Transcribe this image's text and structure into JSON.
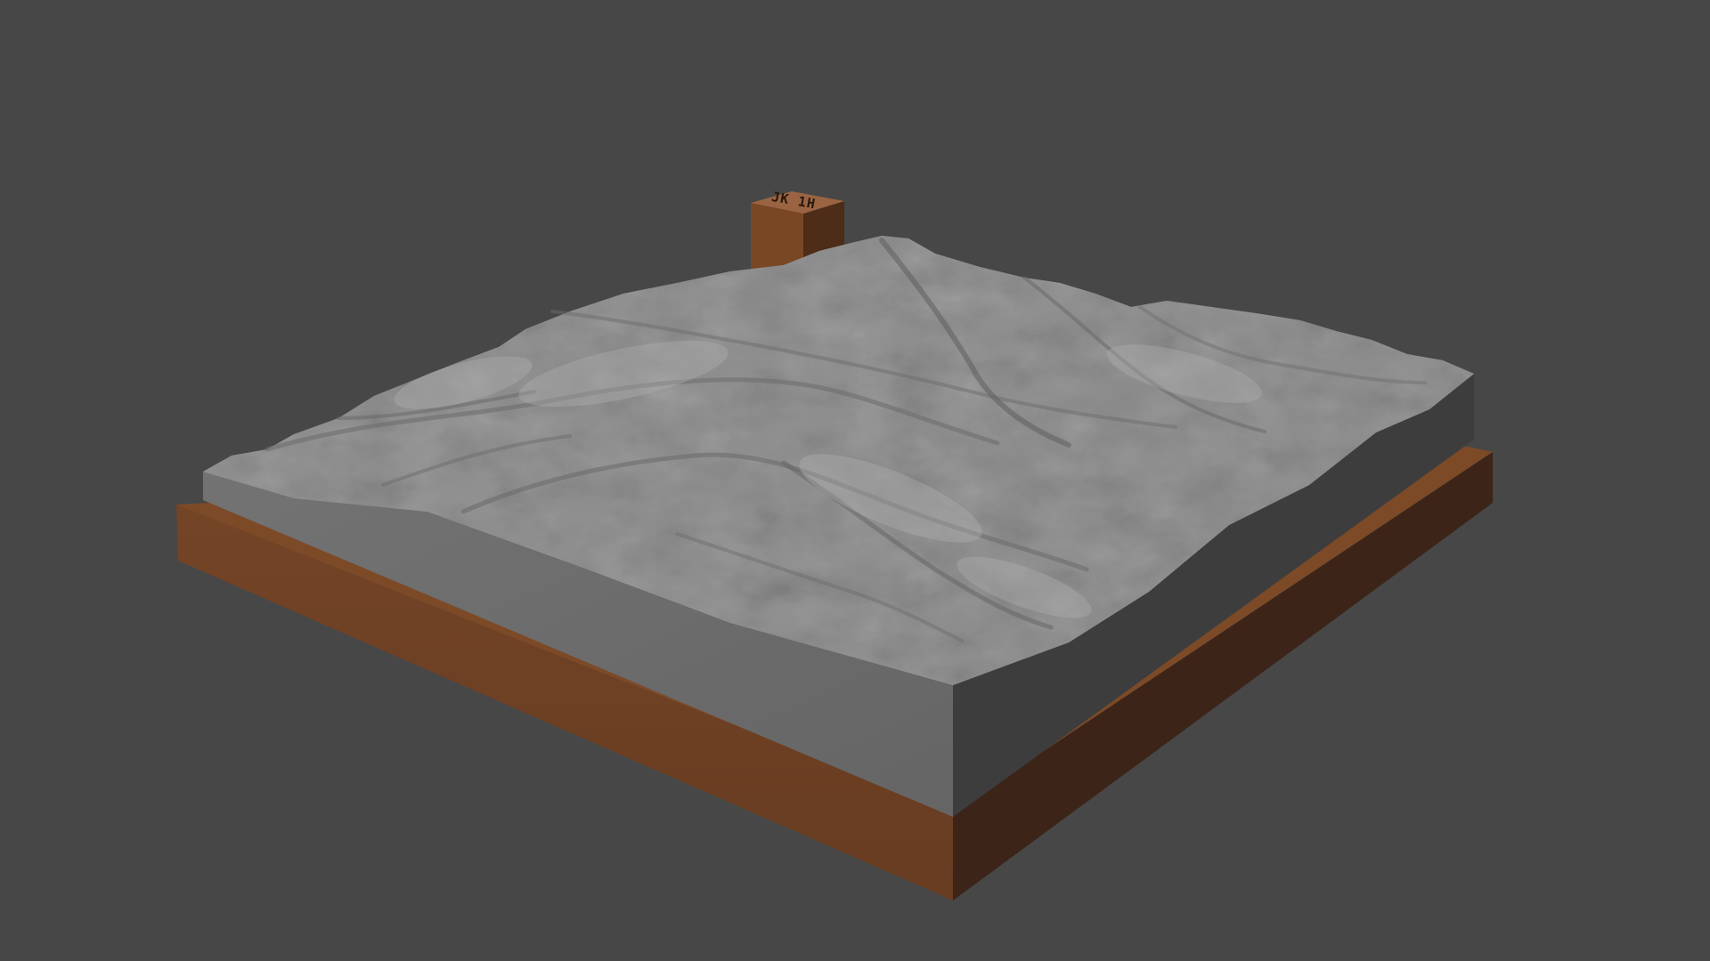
{
  "scene": {
    "background_color": "#474747",
    "object": "3d-printed-terrain-relief-model",
    "colors": {
      "base_front": "#6e4124",
      "base_top": "#7d4a28",
      "base_right": "#3c2418",
      "block_front": "#6b6b6b",
      "block_right": "#3d3d3d",
      "terrain_light": "#a4a4a4",
      "terrain_mid": "#8c8c8c",
      "terrain_dark": "#5e5e5e",
      "tag_front": "#7a4725",
      "tag_side": "#4d2c18",
      "tag_top": "#9a6442"
    },
    "tag": {
      "engraving": "JK 1H"
    }
  }
}
